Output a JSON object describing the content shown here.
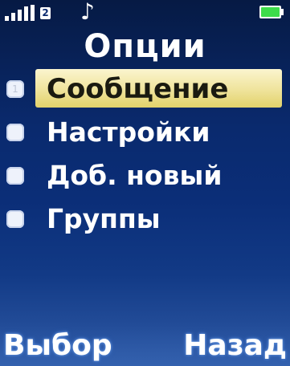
{
  "status_bar": {
    "signal_icon": "signal-bars-icon",
    "sim_label": "2",
    "music_icon": "♪",
    "battery_icon": "battery-icon"
  },
  "title": "Опции",
  "menu": {
    "items": [
      {
        "label": "Сообщение",
        "selected": true,
        "bullet": "1"
      },
      {
        "label": "Настройки",
        "selected": false
      },
      {
        "label": "Доб. новый",
        "selected": false
      },
      {
        "label": "Группы",
        "selected": false
      }
    ]
  },
  "softkeys": {
    "left": "Выбор",
    "right": "Назад"
  },
  "colors": {
    "background_top": "#061a44",
    "background_bottom": "#2f5aa6",
    "highlight": "#efe39b",
    "battery": "#3ddc4a"
  }
}
